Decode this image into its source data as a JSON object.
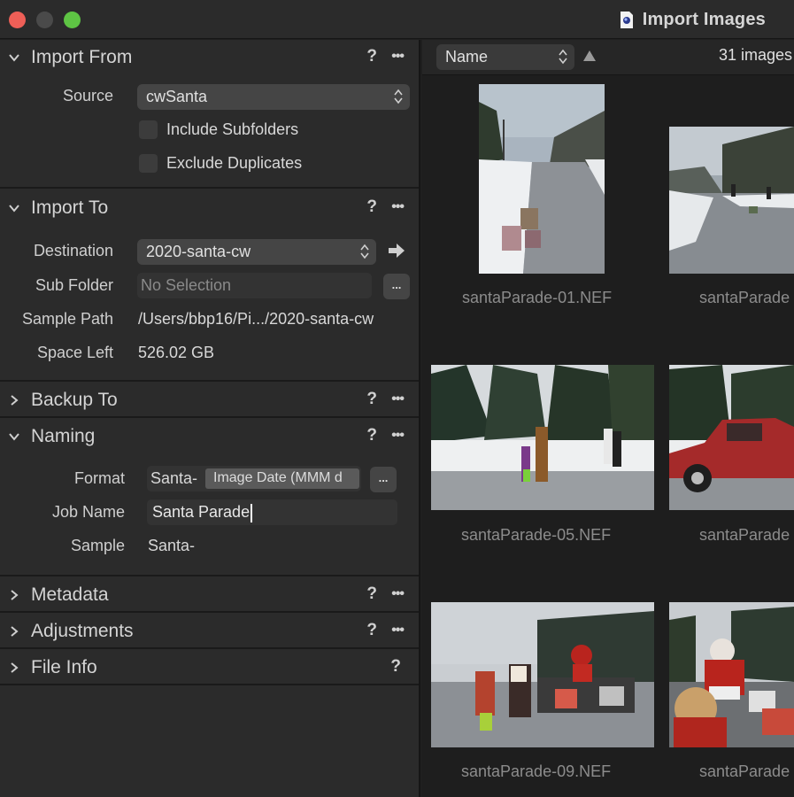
{
  "window": {
    "title": "Import Images"
  },
  "import_from": {
    "title": "Import From",
    "help": "?",
    "more": "•••",
    "source_label": "Source",
    "source_value": "cwSanta",
    "include_subfolders": "Include Subfolders",
    "exclude_duplicates": "Exclude Duplicates"
  },
  "import_to": {
    "title": "Import To",
    "help": "?",
    "more": "•••",
    "destination_label": "Destination",
    "destination_value": "2020-santa-cw",
    "subfolder_label": "Sub Folder",
    "subfolder_placeholder": "No Selection",
    "browse_button": "...",
    "sample_path_label": "Sample Path",
    "sample_path_value": "/Users/bbp16/Pi.../2020-santa-cw",
    "space_left_label": "Space Left",
    "space_left_value": "526.02 GB"
  },
  "backup_to": {
    "title": "Backup To",
    "help": "?",
    "more": "•••"
  },
  "naming": {
    "title": "Naming",
    "help": "?",
    "more": "•••",
    "format_label": "Format",
    "format_prefix": "Santa-",
    "format_token": "Image Date (MMM d",
    "format_button": "...",
    "job_name_label": "Job Name",
    "job_name_value": "Santa Parade",
    "sample_label": "Sample",
    "sample_value": "Santa-"
  },
  "metadata": {
    "title": "Metadata",
    "help": "?",
    "more": "•••"
  },
  "adjustments": {
    "title": "Adjustments",
    "help": "?",
    "more": "•••"
  },
  "file_info": {
    "title": "File Info",
    "help": "?"
  },
  "browser": {
    "sort_field": "Name",
    "count": "31 images",
    "thumbnails": [
      {
        "filename": "santaParade-01.NEF"
      },
      {
        "filename": "santaParade"
      },
      {
        "filename": "santaParade-05.NEF"
      },
      {
        "filename": "santaParade"
      },
      {
        "filename": "santaParade-09.NEF"
      },
      {
        "filename": "santaParade"
      }
    ]
  },
  "colors": {
    "panel_bg": "#2b2b2b",
    "browser_bg": "#1e1e1e",
    "close": "#ee5f57",
    "zoom": "#5ec444"
  }
}
